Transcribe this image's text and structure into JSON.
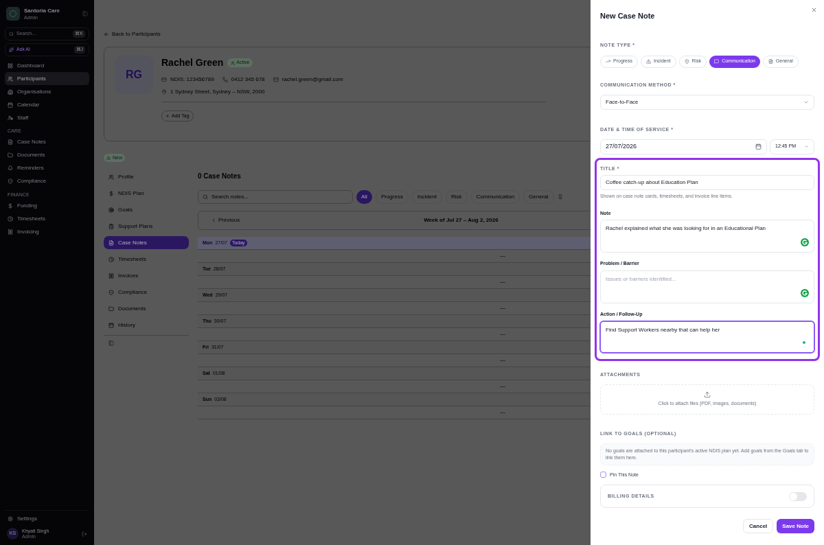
{
  "sidebar": {
    "brand": {
      "name": "Santoria Care",
      "role": "Admin"
    },
    "search": {
      "placeholder": "Search...",
      "shortcut": "⌘K"
    },
    "ask_ai": {
      "label": "Ask AI",
      "shortcut": "⌘J"
    },
    "sections": [
      {
        "items": [
          {
            "label": "Dashboard",
            "selected": false
          },
          {
            "label": "Participants",
            "selected": true
          },
          {
            "label": "Organisations",
            "selected": false
          },
          {
            "label": "Calendar",
            "selected": false
          },
          {
            "label": "Staff",
            "selected": false
          }
        ]
      },
      {
        "heading": "CARE",
        "items": [
          {
            "label": "Case Notes",
            "selected": false
          },
          {
            "label": "Documents",
            "selected": false
          },
          {
            "label": "Reminders",
            "selected": false
          },
          {
            "label": "Compliance",
            "selected": false
          }
        ]
      },
      {
        "heading": "FINANCE",
        "items": [
          {
            "label": "Funding",
            "selected": false
          },
          {
            "label": "Timesheets",
            "selected": false
          },
          {
            "label": "Invoicing",
            "selected": false
          }
        ]
      }
    ],
    "settings": "Settings",
    "user": {
      "initials": "KS",
      "name": "Khyati Singh",
      "role": "Admin"
    }
  },
  "main": {
    "back_link": "Back to Participants",
    "participant": {
      "initials": "RG",
      "name": "Rachel Green",
      "status": "Active",
      "ndis": "NDIS: 123456789",
      "phone": "0412 345 678",
      "email": "rachel.green@gmail.com",
      "address": "1 Sydney Street, Sydney – NSW, 2000",
      "add_tag": "Add Tag"
    },
    "badge": "New",
    "tabs": [
      {
        "label": "Profile",
        "selected": false
      },
      {
        "label": "NDIS Plan",
        "selected": false
      },
      {
        "label": "Goals",
        "selected": false
      },
      {
        "label": "Support Plans",
        "selected": false
      },
      {
        "label": "Case Notes",
        "selected": true
      },
      {
        "label": "Timesheets",
        "selected": false
      },
      {
        "label": "Invoices",
        "selected": false
      },
      {
        "label": "Compliance",
        "selected": false
      },
      {
        "label": "Documents",
        "selected": false
      },
      {
        "label": "History",
        "selected": false
      }
    ],
    "case_notes": {
      "title": "0 Case Notes",
      "search_placeholder": "Search notes...",
      "filters": [
        {
          "label": "All",
          "selected": true
        },
        {
          "label": "Progress",
          "selected": false
        },
        {
          "label": "Incident",
          "selected": false
        },
        {
          "label": "Risk",
          "selected": false
        },
        {
          "label": "Communication",
          "selected": false
        },
        {
          "label": "General",
          "selected": false
        }
      ],
      "previous": "Previous",
      "week": "Week of Jul 27 – Aug 2, 2026",
      "days": [
        {
          "day": "Mon",
          "date": "27/07",
          "today": "Today",
          "empty": "—"
        },
        {
          "day": "Tue",
          "date": "28/07",
          "empty": "—"
        },
        {
          "day": "Wed",
          "date": "29/07",
          "empty": "—"
        },
        {
          "day": "Thu",
          "date": "30/07",
          "empty": "—"
        },
        {
          "day": "Fri",
          "date": "31/07",
          "empty": "—"
        },
        {
          "day": "Sat",
          "date": "01/08",
          "empty": "—"
        },
        {
          "day": "Sun",
          "date": "02/08",
          "empty": "—"
        }
      ]
    }
  },
  "drawer": {
    "title": "New Case Note",
    "note_type": {
      "label": "NOTE TYPE *",
      "options": [
        {
          "label": "Progress",
          "selected": false
        },
        {
          "label": "Incident",
          "selected": false
        },
        {
          "label": "Risk",
          "selected": false
        },
        {
          "label": "Communication",
          "selected": true
        },
        {
          "label": "General",
          "selected": false
        }
      ]
    },
    "method": {
      "label": "COMMUNICATION METHOD *",
      "value": "Face-to-Face"
    },
    "datetime": {
      "label": "DATE & TIME OF SERVICE *",
      "date": "27/07/2026",
      "time": "12:45 PM"
    },
    "title_field": {
      "label": "TITLE *",
      "value": "Coffee catch-up about Education Plan",
      "hint": "Shown on case note cards, timesheets, and invoice line items."
    },
    "text_fields": [
      {
        "label": "Note",
        "value": "Rachel explained what she was looking for in an Educational Plan",
        "focused": false
      },
      {
        "label": "Problem / Barrier",
        "placeholder": "Issues or barriers identified...",
        "focused": false
      },
      {
        "label": "Action / Follow-Up",
        "value": "Find Support Workers nearby that can help her",
        "focused": true
      }
    ],
    "attachments": {
      "label": "ATTACHMENTS",
      "text": "Click to attach files (PDF, images, documents)"
    },
    "goals": {
      "label": "LINK TO GOALS (OPTIONAL)",
      "text": "No goals are attached to this participant's active NDIS plan yet. Add goals from the Goals tab to link them here."
    },
    "pin": {
      "label": "Pin This Note",
      "checked": false
    },
    "billing": {
      "label": "BILLING DETAILS",
      "on": false
    },
    "buttons": {
      "cancel": "Cancel",
      "save": "Save Note"
    }
  }
}
